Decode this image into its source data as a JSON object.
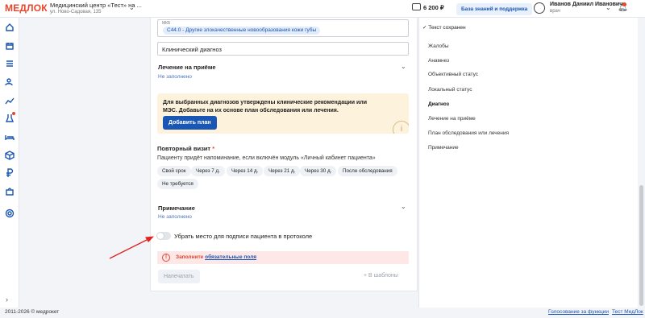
{
  "header": {
    "logo": "МЕДЛОК",
    "clinic_name": "Медицинский центр «Тест» на ...",
    "clinic_address": "ул. Ново-Садовая, 135",
    "balance": "6 200 ₽",
    "kb_button": "База знаний и поддержка",
    "user_name": "Иванов Даниил Иванович",
    "user_role": "врач"
  },
  "sidebar": {
    "icons": [
      "home-icon",
      "calendar-icon",
      "list-icon",
      "patients-icon",
      "chart-icon",
      "flask-icon",
      "bed-icon",
      "box-icon",
      "ruble-icon",
      "puzzle-icon",
      "settings-icon"
    ],
    "expand": "›"
  },
  "form": {
    "mkb_label": "МКБ",
    "mkb_chip": "C44.0 - Другие злокачественные новообразования кожи губы",
    "clinical_diagnosis": "Клинический диагноз",
    "treatment_title": "Лечение на приёме",
    "treatment_value": "Не заполнено",
    "notice_text": "Для выбранных диагнозов утверждены клинические рекомендации или МЭС. Добавьте на их основе план обследования или лечения.",
    "add_plan": "Добавить план",
    "repeat_title": "Повторный визит",
    "repeat_star": "*",
    "repeat_hint": "Пациенту придёт напоминание, если включён модуль «Личный кабинет пациента»",
    "periods": [
      "Свой срок",
      "Через 7 д.",
      "Через 14 д.",
      "Через 21 д.",
      "Через 30 д.",
      "После обследования",
      "Не требуется"
    ],
    "note_title": "Примечание",
    "note_value": "Не заполнено",
    "toggle_label": "Убрать место для подписи пациента в протоколе",
    "error_text": "Заполните",
    "error_link": "обязательные поля",
    "print_button": "Напечатать",
    "templates_button": "+  В шаблоны"
  },
  "right_panel": {
    "saved": "✓ Текст сохранен",
    "items": [
      "Жалобы",
      "Анамнез",
      "Объективный статус",
      "Локальный статус",
      "Диагноз",
      "Лечение на приёме",
      "План обследования или лечения",
      "Примечание"
    ],
    "active": "Диагноз"
  },
  "footer": {
    "copyright": "2011-2026 © медрокет",
    "link1": "Голосование за функции",
    "link2": "Тест МедЛок"
  },
  "colors": {
    "accent": "#1a56b4",
    "brand": "#e8452c",
    "notice_bg": "#fdf2dc",
    "error_bg": "#fde7e7",
    "arrow": "#e0231c"
  }
}
